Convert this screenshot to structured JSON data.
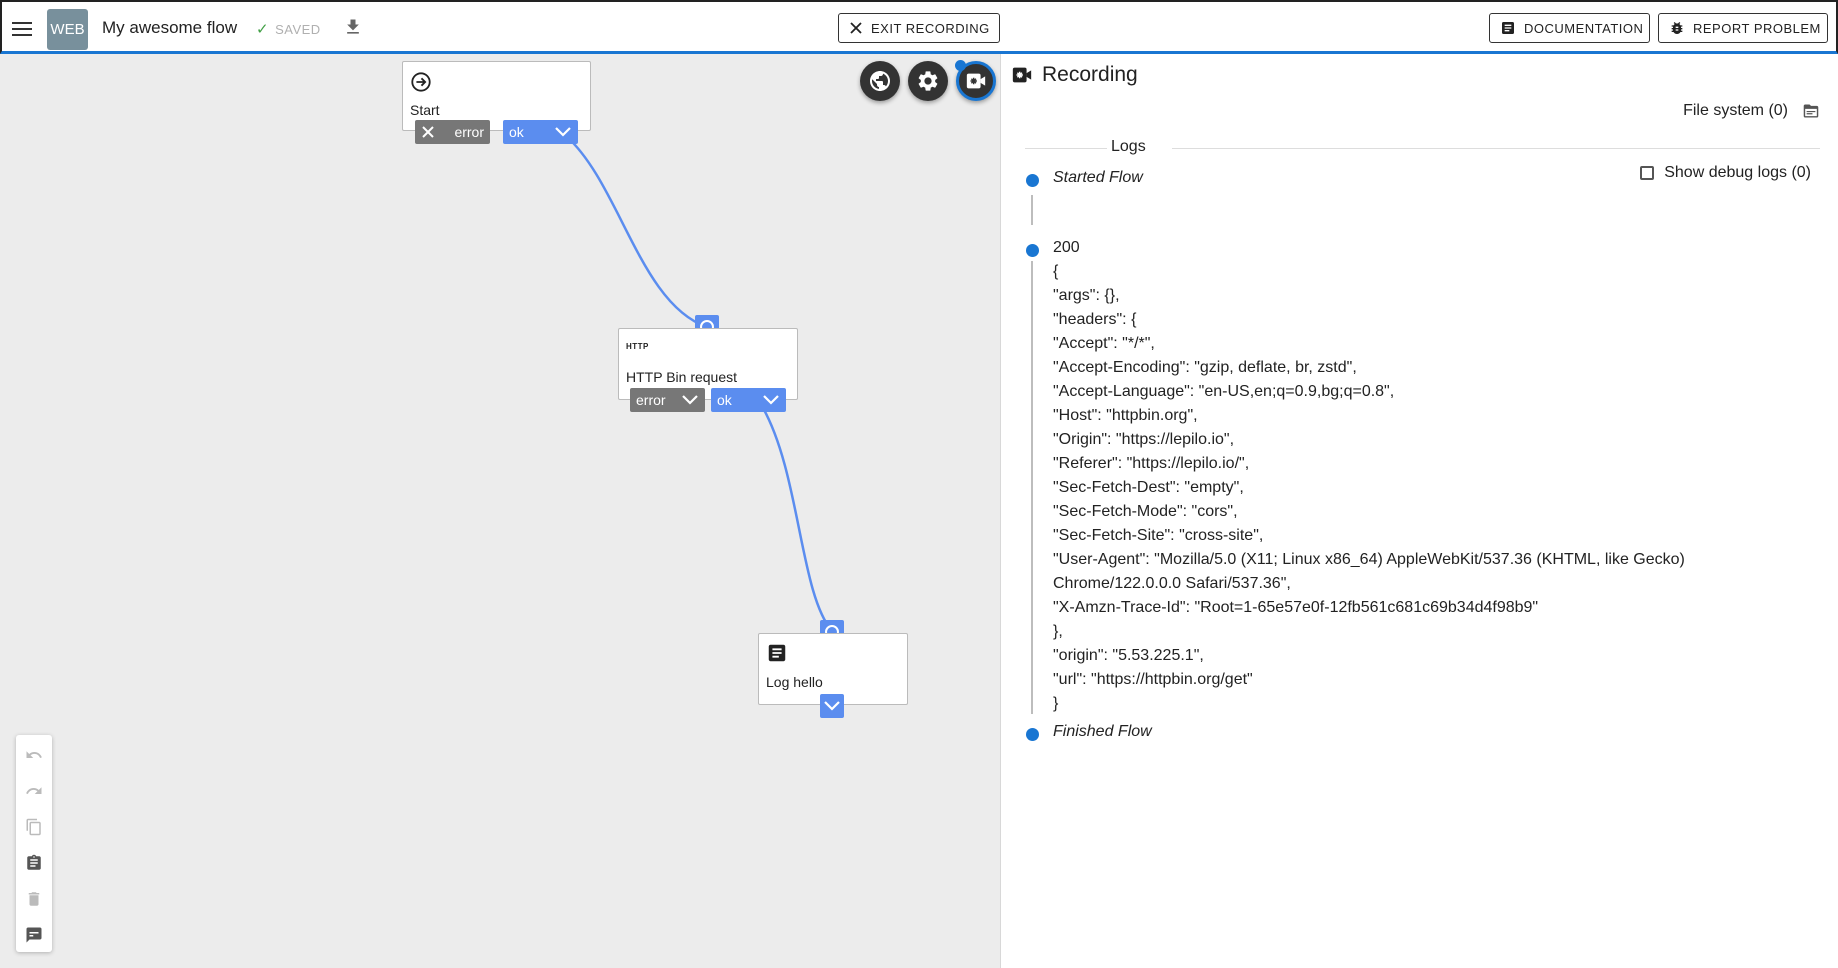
{
  "header": {
    "app_badge": "WEB",
    "flow_name": "My awesome flow",
    "saved_label": "SAVED",
    "exit_recording_label": "EXIT RECORDING",
    "documentation_label": "DOCUMENTATION",
    "report_problem_label": "REPORT PROBLEM"
  },
  "canvas": {
    "nodes": {
      "start": {
        "label": "Start",
        "error_port": "error",
        "ok_port": "ok",
        "icon": "arrow-circle-right-icon"
      },
      "http": {
        "tag": "HTTP",
        "label": "HTTP Bin request",
        "error_port": "error",
        "ok_port": "ok"
      },
      "log": {
        "label": "Log hello",
        "icon": "article-icon"
      }
    },
    "fab_icons": [
      "globe-icon",
      "gear-icon",
      "recording-icon"
    ],
    "tool_icons": [
      "undo-icon",
      "redo-icon",
      "copy-icon",
      "paste-icon",
      "delete-icon",
      "comment-icon"
    ]
  },
  "panel": {
    "title": "Recording",
    "file_system_label": "File system (0)",
    "logs_label": "Logs",
    "debug_label": "Show debug logs (0)",
    "entries": [
      {
        "head": "Started Flow",
        "body": ""
      },
      {
        "head": "200",
        "body": "{\n\"args\": {},\n\"headers\": {\n\"Accept\": \"*/*\",\n\"Accept-Encoding\": \"gzip, deflate, br, zstd\",\n\"Accept-Language\": \"en-US,en;q=0.9,bg;q=0.8\",\n\"Host\": \"httpbin.org\",\n\"Origin\": \"https://lepilo.io\",\n\"Referer\": \"https://lepilo.io/\",\n\"Sec-Fetch-Dest\": \"empty\",\n\"Sec-Fetch-Mode\": \"cors\",\n\"Sec-Fetch-Site\": \"cross-site\",\n\"User-Agent\": \"Mozilla/5.0 (X11; Linux x86_64) AppleWebKit/537.36 (KHTML, like Gecko) Chrome/122.0.0.0 Safari/537.36\",\n\"X-Amzn-Trace-Id\": \"Root=1-65e57e0f-12fb561c681c69b34d4f98b9\"\n},\n\"origin\": \"5.53.225.1\",\n\"url\": \"https://httpbin.org/get\"\n}"
      },
      {
        "head": "Finished Flow",
        "body": ""
      }
    ]
  },
  "colors": {
    "accent": "#1976d2",
    "port_ok": "#5b8def",
    "port_error": "#777777",
    "canvas_bg": "#ececec"
  }
}
